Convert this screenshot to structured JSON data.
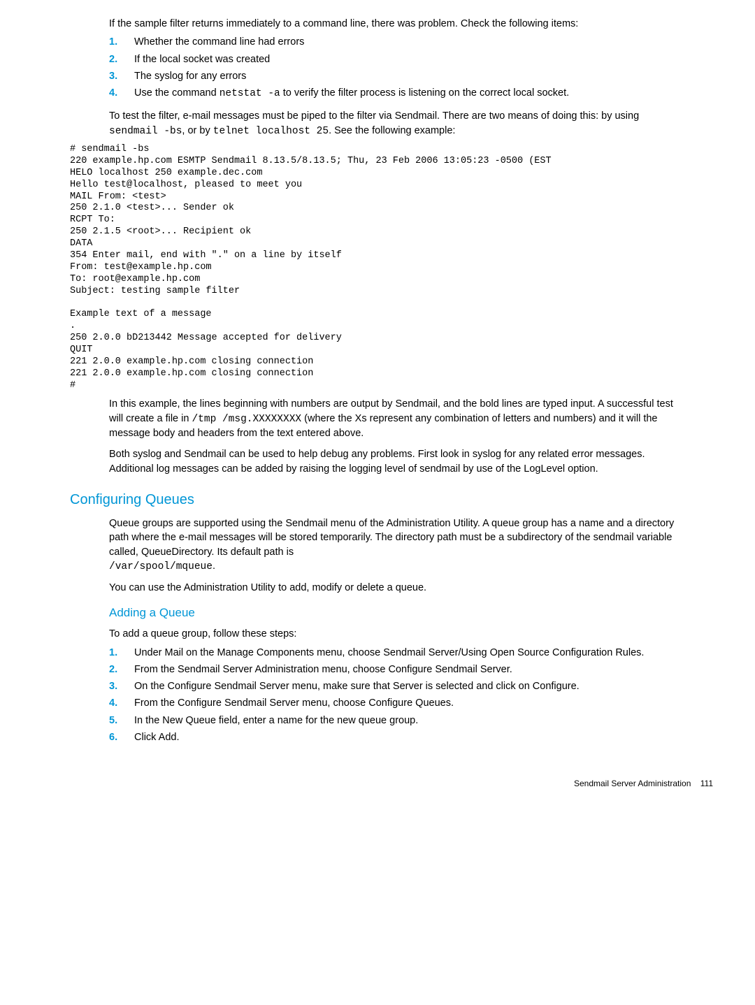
{
  "intro": {
    "p1": "If the sample filter returns immediately to a command line, there was problem. Check the following items:",
    "list1": [
      "Whether the command line had errors",
      "If the local socket was created",
      "The syslog for any errors"
    ],
    "li4_prefix": "Use the command ",
    "li4_code": "netstat -a",
    "li4_suffix": " to verify the filter process is listening on the correct local socket.",
    "p2_prefix": "To test the filter, e-mail messages must be piped to the filter via Sendmail. There are two means of doing this: by using ",
    "p2_code1": "sendmail -bs",
    "p2_mid": ", or by ",
    "p2_code2": "telnet localhost 25",
    "p2_suffix": ". See the following example:"
  },
  "code_block": "# sendmail -bs\n220 example.hp.com ESMTP Sendmail 8.13.5/8.13.5; Thu, 23 Feb 2006 13:05:23 -0500 (EST\nHELO localhost 250 example.dec.com\nHello test@localhost, pleased to meet you\nMAIL From: <test>\n250 2.1.0 <test>... Sender ok\nRCPT To:\n250 2.1.5 <root>... Recipient ok\nDATA\n354 Enter mail, end with \".\" on a line by itself\nFrom: test@example.hp.com\nTo: root@example.hp.com\nSubject: testing sample filter\n\nExample text of a message\n.\n250 2.0.0 bD213442 Message accepted for delivery\nQUIT\n221 2.0.0 example.hp.com closing connection\n221 2.0.0 example.hp.com closing connection\n#",
  "after_code": {
    "p1_prefix": "In this example, the lines beginning with numbers are output by Sendmail, and the bold lines are typed input. A successful test will create a file in ",
    "p1_code": "/tmp /msg.XXXXXXXX",
    "p1_suffix": " (where the Xs represent any combination of letters and numbers) and it will the message body and headers from the text entered above.",
    "p2": "Both syslog and Sendmail can be used to help debug any problems. First look in syslog for any related error messages. Additional log messages can be added by raising the logging level of sendmail by use of the LogLevel option."
  },
  "queues": {
    "heading": "Configuring Queues",
    "p1_prefix": "Queue groups are supported using the Sendmail menu of the Administration Utility. A queue group has a name and a directory path where the e-mail messages will be stored temporarily. The directory path must be a subdirectory of the sendmail variable called, QueueDirectory. Its default path is ",
    "p1_code": "/var/spool/mqueue",
    "p1_suffix": ".",
    "p2": "You can use the Administration Utility to add, modify or delete a queue."
  },
  "adding": {
    "heading": "Adding a Queue",
    "intro": "To add a queue group, follow these steps:",
    "steps": [
      "Under Mail on the Manage Components menu, choose Sendmail Server/Using Open Source Configuration Rules.",
      "From the Sendmail Server Administration menu, choose Configure Sendmail Server.",
      "On the Configure Sendmail Server menu, make sure that Server is selected and click on Configure.",
      "From the Configure Sendmail Server menu, choose Configure Queues.",
      "In the New Queue field, enter a name for the new queue group.",
      "Click Add."
    ]
  },
  "footer": {
    "label": "Sendmail Server Administration",
    "page": "111"
  }
}
